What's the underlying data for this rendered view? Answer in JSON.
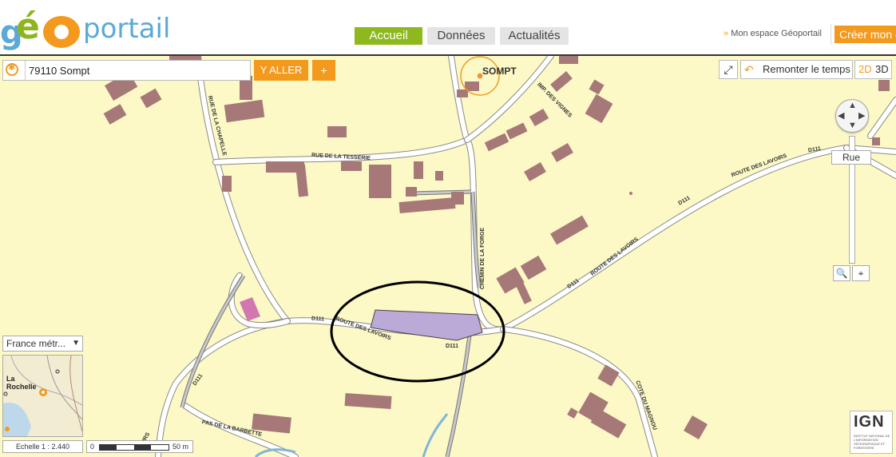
{
  "header": {
    "logo_ge": "g",
    "logo_e": "é",
    "logo_portail": "portail",
    "tabs": [
      "Accueil",
      "Données",
      "Actualités"
    ],
    "my_space_prefix": "»",
    "my_space": "Mon espace Géoportail",
    "create_button": "Créer mon e"
  },
  "search": {
    "value": "79110 Sompt",
    "go_label": "Y ALLER",
    "plus_label": "+"
  },
  "map_controls": {
    "fullscreen_glyph": "⤢",
    "time_icon": "↶",
    "time_label": "Remonter le temps",
    "mode_2d": "2D",
    "mode_3d": "3D",
    "street_label": "Rue",
    "zoom_glyph": "🔍",
    "center_glyph": "⌖"
  },
  "projection": {
    "label": "France métr...",
    "arrow": "▼"
  },
  "overview": {
    "place_1": "La",
    "place_2": "Rochelle"
  },
  "scale": {
    "ratio_label": "Echelle 1 :  2.440",
    "zero": "0",
    "distance": "50 m"
  },
  "ign": {
    "logo": "IGN",
    "subtitle": "INSTITUT NATIONAL DE L'INFORMATION GÉOGRAPHIQUE ET FORESTIÈRE"
  },
  "map_labels": {
    "town": "SOMPT",
    "rue_chapelle": "RUE DE LA CHAPELLE",
    "rue_tesserie": "RUE DE LA TESSERIE",
    "imp_vignes": "IMP. DES VIGNES",
    "chemin_forge": "CHEMIN DE LA FORGE",
    "route_lavoirs_1": "ROUTE DES LAVOIRS",
    "route_lavoirs_2": "ROUTE DES LAVOIRS",
    "route_lavoirs_3": "ROUTE DES LAVOIRS",
    "d111_a": "D111",
    "d111_b": "D111",
    "d111_c": "D111",
    "d111_d": "D111",
    "d111_e": "D111",
    "d111_f": "D111",
    "d111_g": "D111",
    "cote_magnou": "COTE DU MAGNOU",
    "pas_barbette": "PAS DE LA BARBETTE",
    "voirs": "VOIRS"
  },
  "colors": {
    "map_background": "#fcf9c6",
    "building": "#a77878",
    "selected_parcel": "#bba9d8",
    "accent_orange": "#f39a1e",
    "accent_green": "#8db81e",
    "logo_blue": "#5aa9d6"
  }
}
